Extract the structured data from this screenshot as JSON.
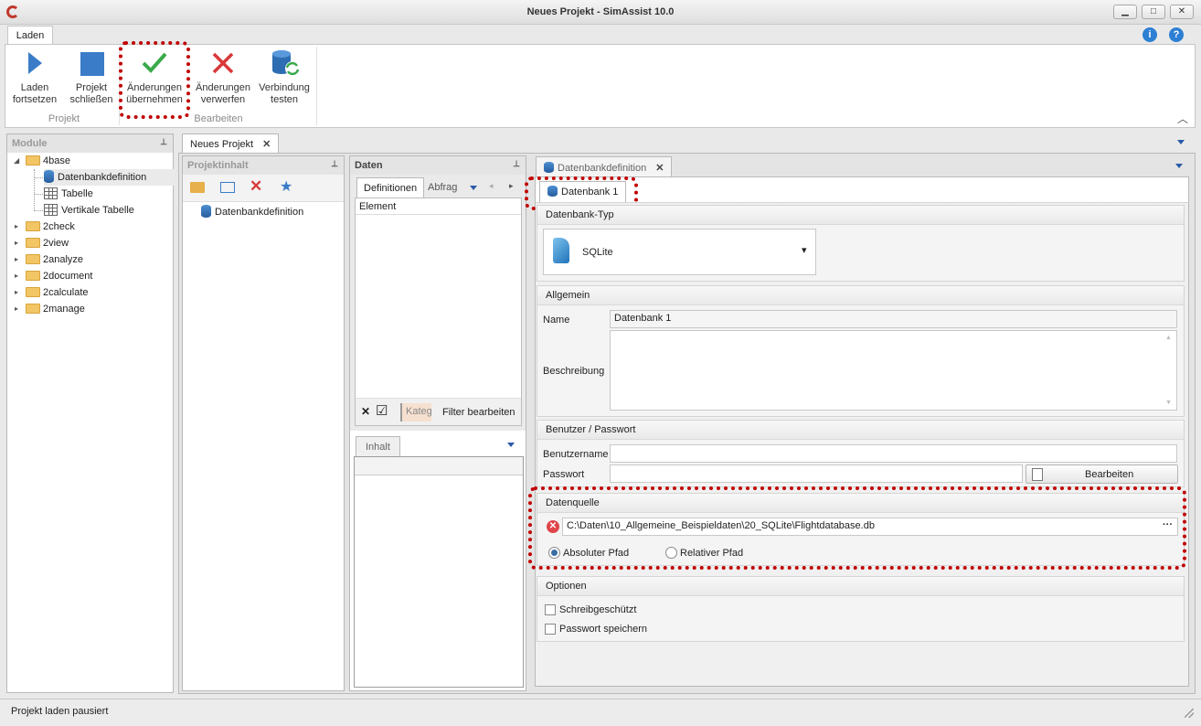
{
  "window": {
    "title": "Neues Projekt - SimAssist 10.0",
    "minimize": "▁",
    "maximize": "□",
    "close": "✕"
  },
  "ribbon": {
    "tab": "Laden",
    "info_icon": "i",
    "help_icon": "?",
    "buttons": {
      "laden_fortsetzen": [
        "Laden",
        "fortsetzen"
      ],
      "projekt_schliessen": [
        "Projekt",
        "schließen"
      ],
      "aenderungen_uebernehmen": [
        "Änderungen",
        "übernehmen"
      ],
      "aenderungen_verwerfen": [
        "Änderungen",
        "verwerfen"
      ],
      "verbindung_testen": [
        "Verbindung",
        "testen"
      ]
    },
    "groups": {
      "projekt": "Projekt",
      "bearbeiten": "Bearbeiten"
    },
    "collapse_icon": "︿"
  },
  "module_panel": {
    "title": "Module",
    "pin": "📌",
    "items": [
      {
        "label": "4base",
        "expanded": true
      },
      {
        "label": "Datenbankdefinition"
      },
      {
        "label": "Tabelle"
      },
      {
        "label": "Vertikale Tabelle"
      },
      {
        "label": "2check"
      },
      {
        "label": "2view"
      },
      {
        "label": "2analyze"
      },
      {
        "label": "2document"
      },
      {
        "label": "2calculate"
      },
      {
        "label": "2manage"
      }
    ]
  },
  "doc_tab": {
    "label": "Neues Projekt",
    "close": "✕"
  },
  "projektinhalt": {
    "title": "Projektinhalt",
    "item": "Datenbankdefinition"
  },
  "daten": {
    "title": "Daten",
    "tabs": [
      "Definitionen",
      "Abfrag"
    ],
    "column": "Element",
    "filter_x": "✕",
    "filter_check": "☑",
    "kategorie": "Kateg",
    "filter_label": "Filter bearbeiten",
    "inhalt_tab": "Inhalt"
  },
  "editor": {
    "outer_tab": "Datenbankdefinition",
    "close": "✕",
    "inner_tab": "Datenbank 1",
    "db_type": {
      "header": "Datenbank-Typ",
      "value": "SQLite",
      "caret": "▾"
    },
    "allgemein": {
      "header": "Allgemein",
      "name_label": "Name",
      "name_value": "Datenbank 1",
      "desc_label": "Beschreibung",
      "desc_value": ""
    },
    "auth": {
      "header": "Benutzer / Passwort",
      "user_label": "Benutzername",
      "pass_label": "Passwort",
      "edit_button": "Bearbeiten"
    },
    "datenquelle": {
      "header": "Datenquelle",
      "path": "C:\\Daten\\10_Allgemeine_Beispieldaten\\20_SQLite\\Flightdatabase.db",
      "browse": "···",
      "radio_absolute": "Absoluter Pfad",
      "radio_relative": "Relativer Pfad",
      "selected": "absolute"
    },
    "optionen": {
      "header": "Optionen",
      "readonly": "Schreibgeschützt",
      "save_pw": "Passwort speichern"
    }
  },
  "status": {
    "text": "Projekt laden pausiert"
  },
  "colors": {
    "accent_blue": "#3a7cc7",
    "confirm_green": "#3aaa4a",
    "discard_red": "#d9383a",
    "highlight_red": "#c00000"
  }
}
